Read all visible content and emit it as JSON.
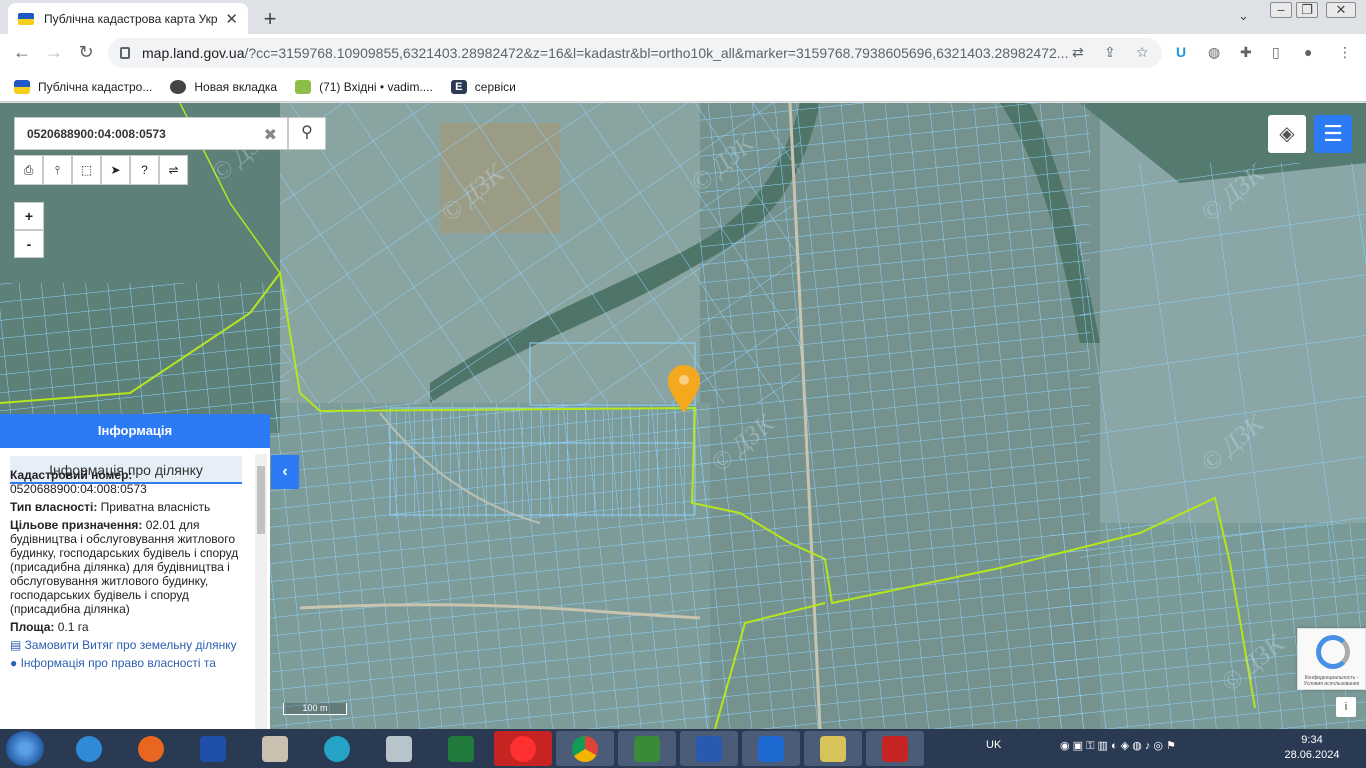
{
  "browser": {
    "tab_title": "Публічна кадастрова карта Укр",
    "url_host": "map.land.gov.ua",
    "url_path": "/?cc=3159768.10909855,6321403.28982472&z=16&l=kadastr&bl=ortho10k_all&marker=3159768.7938605696,6321403.28982472..."
  },
  "bookmarks": [
    {
      "label": "Публічна кадастро...",
      "color": "#2058c8"
    },
    {
      "label": "Новая вкладка",
      "color": "#444444"
    },
    {
      "label": "(71) Вхідні • vadim....",
      "color": "#8bbf4a"
    },
    {
      "label": "сервіси",
      "color": "#2a3a52"
    }
  ],
  "map": {
    "search_value": "0520688900:04:008:0573",
    "zoom_in": "+",
    "zoom_out": "-",
    "scale_label": "100 m",
    "watermark": "© ДЗК",
    "recaptcha_text": "Конфиденциальность - Условия использования",
    "info_button": "i"
  },
  "panel": {
    "header": "Інформація",
    "subheader": "Інформація про ділянку",
    "cadastral_label": "Кадастровий номер:",
    "cadastral_value": "0520688900:04:008:0573",
    "ownership_label": "Тип власності:",
    "ownership_value": "Приватна власність",
    "purpose_label": "Цільове призначення:",
    "purpose_value": "02.01 для будівництва і обслуговування житлового будинку, господарських будівель і споруд (присадибна ділянка) для будівництва і обслуговування житлового будинку, господарських будівель і споруд (присадибна ділянка)",
    "area_label": "Площа:",
    "area_value": "0.1 га",
    "order_link": "Замовити Витяг про земельну ділянку",
    "rights_link": "Інформація про право власності та"
  },
  "taskbar": {
    "lang": "UK",
    "time": "9:34",
    "date": "28.06.2024"
  },
  "colors": {
    "accent": "#2d7bf4",
    "parcel_line": "#7fd0ff",
    "boundary_line": "#b5e61d",
    "marker": "#f4a81d"
  }
}
